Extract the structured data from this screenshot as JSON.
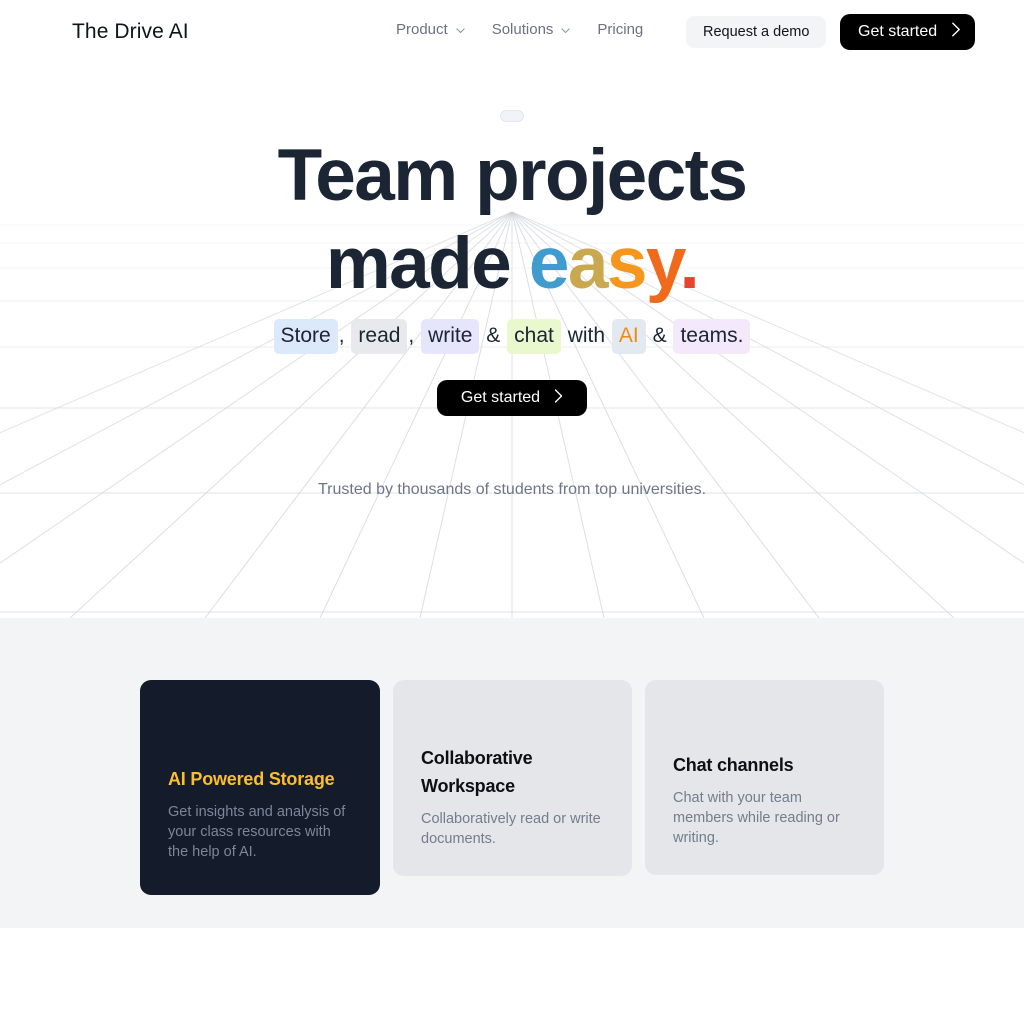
{
  "header": {
    "logo": "The Drive AI",
    "nav": [
      {
        "label": "Product",
        "icon": "chevron-down-icon",
        "has_chevron": true
      },
      {
        "label": "Solutions",
        "icon": "chevron-down-icon",
        "has_chevron": true
      },
      {
        "label": "Pricing",
        "has_chevron": false
      }
    ],
    "demo_button": "Request a demo",
    "start_button": "Get started",
    "start_button_icon": "chevron-right-icon"
  },
  "hero": {
    "badge_pill": "",
    "headline_line1": "Team projects",
    "headline_line2_prefix": "made ",
    "headline_gradient": {
      "e": "e",
      "a": "a",
      "s": "s",
      "y": "y",
      "dot": "."
    },
    "subline": [
      {
        "text": "Store",
        "style": "hl-store"
      },
      {
        "text": ",",
        "style": "plain"
      },
      {
        "text": "read",
        "style": "hl-read"
      },
      {
        "text": ",",
        "style": "plain"
      },
      {
        "text": "write",
        "style": "hl-write"
      },
      {
        "text": "&",
        "style": "plain"
      },
      {
        "text": "chat",
        "style": "hl-chat"
      },
      {
        "text": "with",
        "style": "plain"
      },
      {
        "text": "AI",
        "style": "hl-ai"
      },
      {
        "text": "&",
        "style": "plain"
      },
      {
        "text": "teams.",
        "style": "hl-teams"
      }
    ],
    "subline_parts": {
      "store": "Store",
      "comma1": ",",
      "read": "read",
      "comma2": ",",
      "write": "write",
      "amp1": "&",
      "chat": "chat",
      "with": "with",
      "ai": "AI",
      "amp2": "&",
      "teams": "teams."
    },
    "cta_button": "Get started",
    "cta_icon": "chevron-right-icon",
    "trusted_text": "Trusted by thousands of students from top universities."
  },
  "features": {
    "cards": [
      {
        "title": "AI Powered Storage",
        "body": "Get insights and analysis of your class resources with the help of AI.",
        "theme": "dark"
      },
      {
        "title": "Collaborative Workspace",
        "body": "Collaboratively read or write documents.",
        "theme": "light"
      },
      {
        "title": "Chat channels",
        "body": "Chat with your team members while reading or writing.",
        "theme": "light"
      }
    ]
  },
  "colors": {
    "page_bg": "#ffffff",
    "section_bg": "#f2f4f6",
    "dark_card": "#141b2a",
    "light_card": "#e4e6ea",
    "accent_amber": "#fbbe2c",
    "accent_orange": "#ef8b14",
    "text_dark": "#1b2534",
    "text_muted": "#6d7687",
    "btn_black": "#000000",
    "grad_e": "#3f9ccd",
    "grad_a": "#c9a84f",
    "grad_s": "#f5971e",
    "grad_y": "#ef6a1d",
    "grad_dot": "#e8442d",
    "hl_store": "#dbe9fb",
    "hl_read": "#e7e9ec",
    "hl_write": "#e5e6fb",
    "hl_chat": "#e9f8cd",
    "hl_ai": "#e2e9f1",
    "hl_teams": "#f3e9fb"
  }
}
